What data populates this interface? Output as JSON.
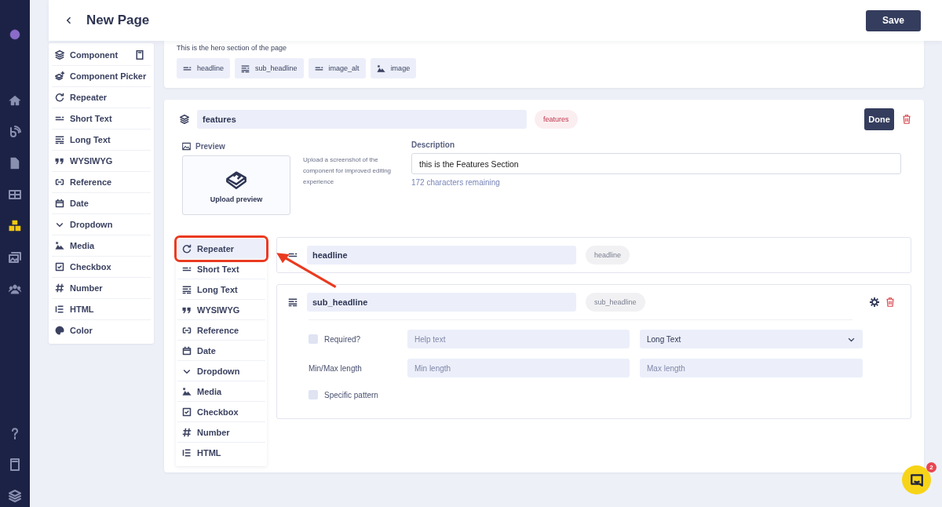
{
  "nav_rail": [
    {
      "kind": "logo",
      "selected": false
    },
    {
      "kind": "home",
      "selected": false
    },
    {
      "kind": "feed",
      "selected": false
    },
    {
      "kind": "document",
      "selected": false
    },
    {
      "kind": "grid",
      "selected": false
    },
    {
      "kind": "cubes",
      "selected": true
    },
    {
      "kind": "images",
      "selected": false
    },
    {
      "kind": "users",
      "selected": false
    },
    {
      "kind": "help",
      "selected": false
    },
    {
      "kind": "book",
      "selected": false
    },
    {
      "kind": "layers",
      "selected": false
    }
  ],
  "header": {
    "title": "New Page",
    "save_button": "Save"
  },
  "palette": [
    {
      "kind": "component",
      "label": "Component"
    },
    {
      "kind": "picker",
      "label": "Component Picker"
    },
    {
      "kind": "repeater",
      "label": "Repeater"
    },
    {
      "kind": "short_text",
      "label": "Short Text"
    },
    {
      "kind": "long_text",
      "label": "Long Text"
    },
    {
      "kind": "wysiwyg",
      "label": "WYSIWYG"
    },
    {
      "kind": "reference",
      "label": "Reference"
    },
    {
      "kind": "date",
      "label": "Date"
    },
    {
      "kind": "dropdown",
      "label": "Dropdown"
    },
    {
      "kind": "media",
      "label": "Media"
    },
    {
      "kind": "checkbox",
      "label": "Checkbox"
    },
    {
      "kind": "number",
      "label": "Number"
    },
    {
      "kind": "html",
      "label": "HTML"
    },
    {
      "kind": "color",
      "label": "Color"
    }
  ],
  "hero_card": {
    "description": "This is the hero section of the page",
    "chips": [
      {
        "kind": "short_text",
        "label": "headline"
      },
      {
        "kind": "long_text",
        "label": "sub_headline"
      },
      {
        "kind": "short_text",
        "label": "image_alt"
      },
      {
        "kind": "media",
        "label": "image"
      }
    ]
  },
  "component_card": {
    "name": "features",
    "api_id": "features",
    "done_button": "Done",
    "preview_label": "Preview",
    "upload_label": "Upload preview",
    "upload_hint": "Upload a screenshot of the component for improved editing experience",
    "description_label": "Description",
    "description_value": "this is the Features Section",
    "description_counter": "172 characters remaining",
    "field_palette": [
      {
        "kind": "repeater",
        "label": "Repeater",
        "selected": true
      },
      {
        "kind": "short_text",
        "label": "Short Text",
        "selected": false
      },
      {
        "kind": "long_text",
        "label": "Long Text",
        "selected": false
      },
      {
        "kind": "wysiwyg",
        "label": "WYSIWYG",
        "selected": false
      },
      {
        "kind": "reference",
        "label": "Reference",
        "selected": false
      },
      {
        "kind": "date",
        "label": "Date",
        "selected": false
      },
      {
        "kind": "dropdown",
        "label": "Dropdown",
        "selected": false
      },
      {
        "kind": "media",
        "label": "Media",
        "selected": false
      },
      {
        "kind": "checkbox",
        "label": "Checkbox",
        "selected": false
      },
      {
        "kind": "number",
        "label": "Number",
        "selected": false
      },
      {
        "kind": "html",
        "label": "HTML",
        "selected": false
      }
    ],
    "fields": [
      {
        "kind": "short_text",
        "name": "headline",
        "api_id": "headline",
        "expanded": false
      },
      {
        "kind": "long_text",
        "name": "sub_headline",
        "api_id": "sub_headline",
        "expanded": true,
        "settings": {
          "required_label": "Required?",
          "required_checked": false,
          "help_placeholder": "Help text",
          "type_value": "Long Text",
          "minmax_label": "Min/Max length",
          "min_placeholder": "Min length",
          "max_placeholder": "Max length",
          "pattern_label": "Specific pattern",
          "pattern_checked": false
        }
      }
    ]
  },
  "chat": {
    "badge": "2"
  }
}
